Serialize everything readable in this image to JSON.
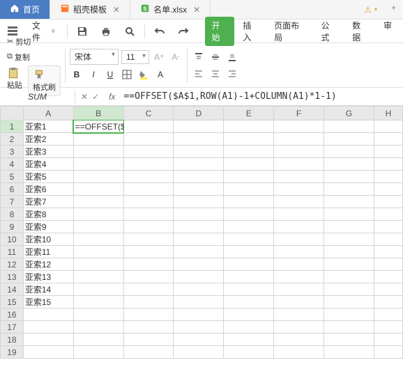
{
  "tabs": {
    "home": "首页",
    "template": "稻壳模板",
    "file": "名单.xlsx",
    "add": "+"
  },
  "menu": {
    "file": "文件",
    "ribbon": [
      "开始",
      "插入",
      "页面布局",
      "公式",
      "数据",
      "审"
    ]
  },
  "clipboard": {
    "cut": "剪切",
    "copy": "复制",
    "paste": "粘贴",
    "brush": "格式刷"
  },
  "font": {
    "name": "宋体",
    "size": "11",
    "bold": "B",
    "italic": "I",
    "underline": "U"
  },
  "namebox": "SUM",
  "fx": {
    "cancel": "✕",
    "confirm": "✓",
    "label": "fx"
  },
  "formula_display": "==OFFSET($A$1,ROW(A1)-1+COLUMN(A1)*1-1)",
  "cell_formula": "==OFFSET($A$1,ROW(A1)-1+COLUMN(A1)*1-1)",
  "active_cell": "B1",
  "columns": [
    "A",
    "B",
    "C",
    "D",
    "E",
    "F",
    "G",
    "H"
  ],
  "row_count": 19,
  "colA_data": [
    "亚索1",
    "亚索2",
    "亚索3",
    "亚索4",
    "亚索5",
    "亚索6",
    "亚索7",
    "亚索8",
    "亚索9",
    "亚索10",
    "亚索11",
    "亚索12",
    "亚索13",
    "亚索14",
    "亚索15"
  ],
  "formula_parts": {
    "p1": "==OFFSET($A$1,ROW(",
    "ref1": "A1",
    "p2": ")-1+COLUMN(",
    "ref2": "A1",
    "p3": ")*1-1)"
  }
}
